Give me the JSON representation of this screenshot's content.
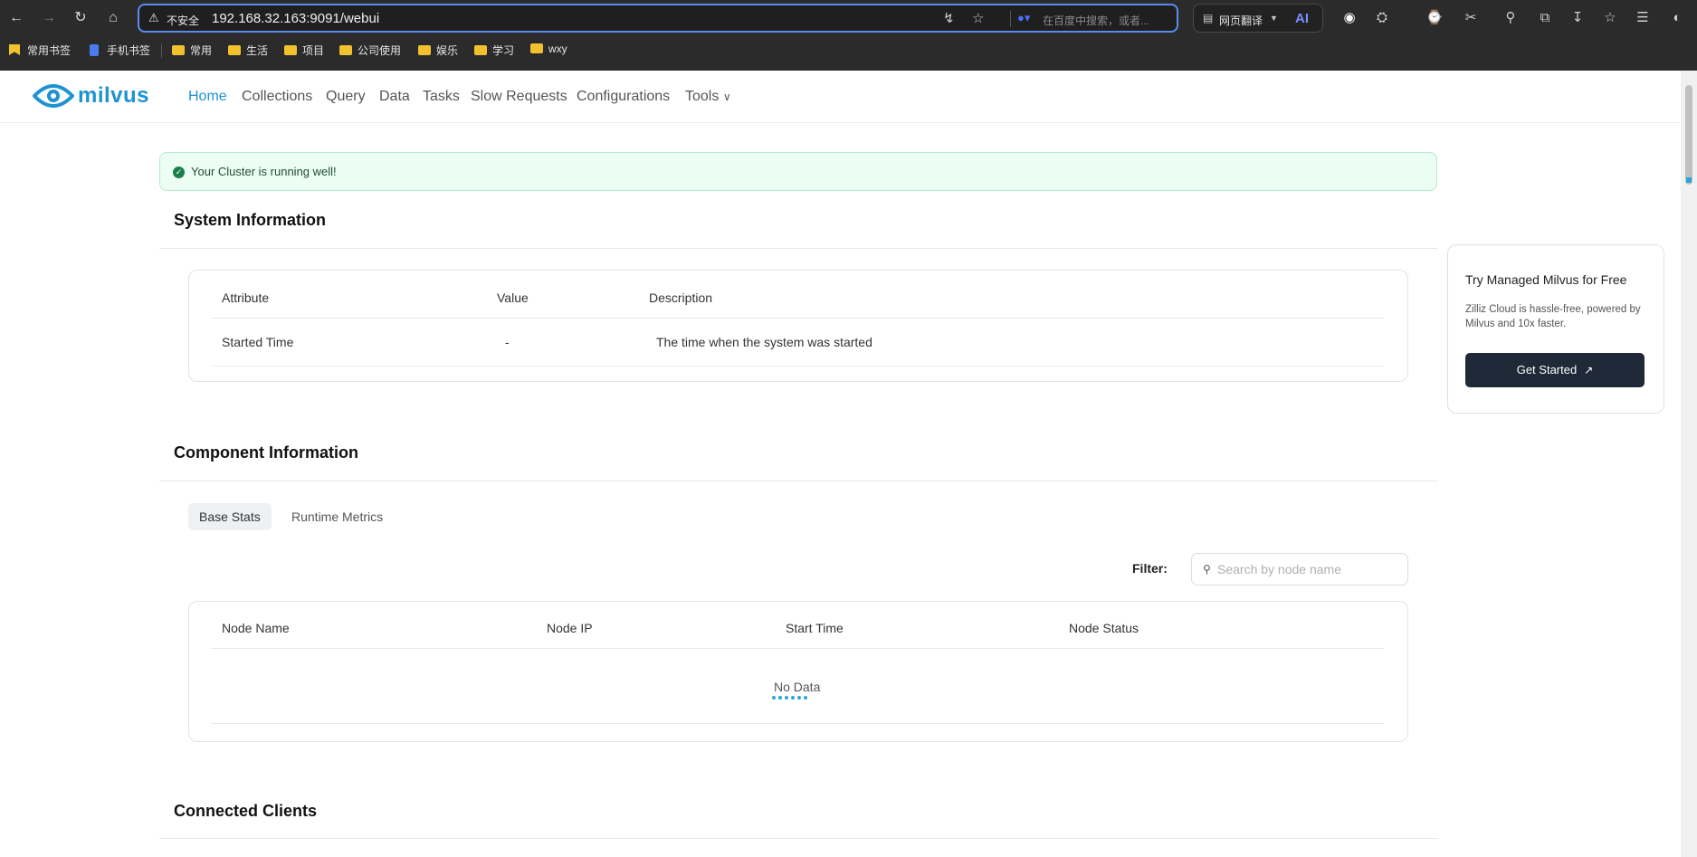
{
  "browser": {
    "url_warning": "不安全",
    "url": "192.168.32.163:9091/webui",
    "search_placeholder": "在百度中搜索，或者...",
    "translate_label": "网页翻译",
    "ai_label": "AI",
    "bookmarks": [
      "常用书签",
      "手机书签",
      "常用",
      "生活",
      "项目",
      "公司使用",
      "娱乐",
      "学习",
      "wxy"
    ]
  },
  "app": {
    "logo_text": "milvus",
    "nav": [
      "Home",
      "Collections",
      "Query",
      "Data",
      "Tasks",
      "Slow Requests",
      "Configurations",
      "Tools"
    ],
    "active_nav": "Home",
    "accent": "#1e93d3"
  },
  "alert": {
    "message": "Your Cluster is running well!"
  },
  "system_info": {
    "title": "System Information",
    "columns": [
      "Attribute",
      "Value",
      "Description"
    ],
    "rows": [
      {
        "attribute": "Started Time",
        "value": "-",
        "description": "The time when the system was started"
      }
    ]
  },
  "component_info": {
    "title": "Component Information",
    "tabs": [
      "Base Stats",
      "Runtime Metrics"
    ],
    "active_tab": "Base Stats",
    "filter_label": "Filter:",
    "filter_placeholder": "Search by node name",
    "columns": [
      "Node Name",
      "Node IP",
      "Start Time",
      "Node Status"
    ],
    "empty_text": "No Data"
  },
  "connected_clients": {
    "title": "Connected Clients"
  },
  "promo": {
    "title": "Try Managed Milvus for Free",
    "description": "Zilliz Cloud is hassle-free, powered by Milvus and 10x faster.",
    "button_label": "Get Started"
  }
}
